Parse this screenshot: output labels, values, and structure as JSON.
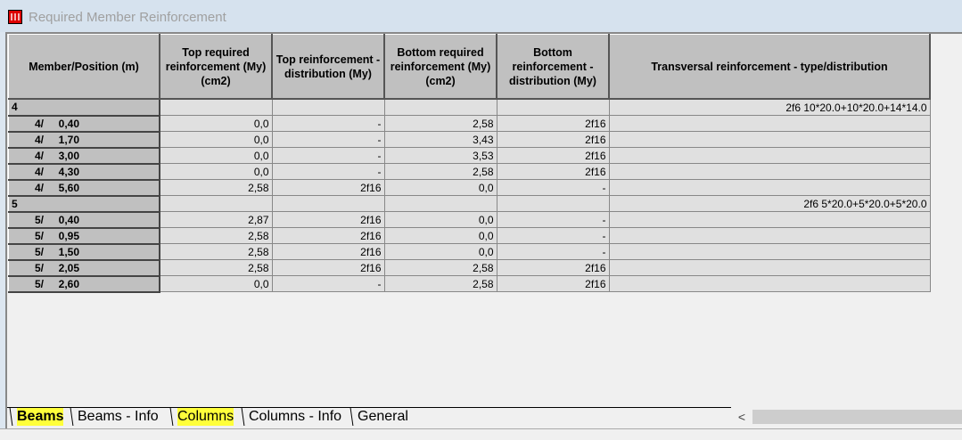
{
  "window": {
    "title": "Required Member Reinforcement"
  },
  "headers": [
    "Member/Position (m)",
    "Top required reinforcement (My) (cm2)",
    "Top reinforcement - distribution (My)",
    "Bottom required reinforcement (My) (cm2)",
    "Bottom reinforcement - distribution (My)",
    "Transversal reinforcement - type/distribution"
  ],
  "groups": [
    {
      "member": "4",
      "transversal": "2f6 10*20.0+10*20.0+14*14.0",
      "rows": [
        {
          "m": "4/",
          "pos": "0,40",
          "top_req": "0,0",
          "top_dist": "-",
          "bot_req": "2,58",
          "bot_dist": "2f16"
        },
        {
          "m": "4/",
          "pos": "1,70",
          "top_req": "0,0",
          "top_dist": "-",
          "bot_req": "3,43",
          "bot_dist": "2f16"
        },
        {
          "m": "4/",
          "pos": "3,00",
          "top_req": "0,0",
          "top_dist": "-",
          "bot_req": "3,53",
          "bot_dist": "2f16"
        },
        {
          "m": "4/",
          "pos": "4,30",
          "top_req": "0,0",
          "top_dist": "-",
          "bot_req": "2,58",
          "bot_dist": "2f16"
        },
        {
          "m": "4/",
          "pos": "5,60",
          "top_req": "2,58",
          "top_dist": "2f16",
          "bot_req": "0,0",
          "bot_dist": "-"
        }
      ]
    },
    {
      "member": "5",
      "transversal": "2f6 5*20.0+5*20.0+5*20.0",
      "rows": [
        {
          "m": "5/",
          "pos": "0,40",
          "top_req": "2,87",
          "top_dist": "2f16",
          "bot_req": "0,0",
          "bot_dist": "-"
        },
        {
          "m": "5/",
          "pos": "0,95",
          "top_req": "2,58",
          "top_dist": "2f16",
          "bot_req": "0,0",
          "bot_dist": "-"
        },
        {
          "m": "5/",
          "pos": "1,50",
          "top_req": "2,58",
          "top_dist": "2f16",
          "bot_req": "0,0",
          "bot_dist": "-"
        },
        {
          "m": "5/",
          "pos": "2,05",
          "top_req": "2,58",
          "top_dist": "2f16",
          "bot_req": "2,58",
          "bot_dist": "2f16"
        },
        {
          "m": "5/",
          "pos": "2,60",
          "top_req": "0,0",
          "top_dist": "-",
          "bot_req": "2,58",
          "bot_dist": "2f16"
        }
      ]
    }
  ],
  "tabs": [
    {
      "label": "Beams",
      "active": true,
      "highlight": true
    },
    {
      "label": "Beams - Info"
    },
    {
      "label": "Columns",
      "highlight": true
    },
    {
      "label": "Columns - Info"
    },
    {
      "label": "General"
    }
  ],
  "scroll_left_glyph": "<"
}
